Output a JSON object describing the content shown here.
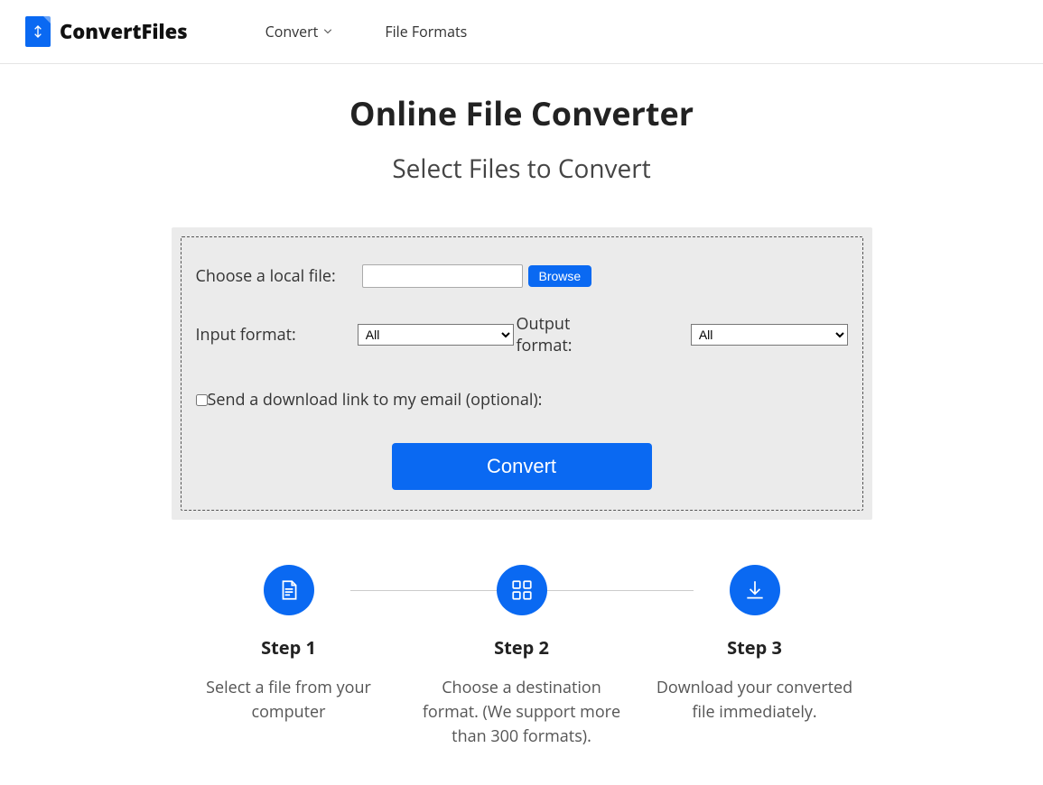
{
  "brand": "ConvertFiles",
  "nav": {
    "convert": "Convert",
    "file_formats": "File Formats"
  },
  "hero": {
    "title": "Online File Converter",
    "subtitle": "Select Files to Convert"
  },
  "form": {
    "choose_label": "Choose a local file:",
    "browse": "Browse",
    "input_format_label": "Input format:",
    "input_selected": "All",
    "output_format_label": "Output format:",
    "output_selected": "All",
    "email_checkbox_label": "Send a download link to my email (optional):",
    "convert": "Convert"
  },
  "steps": {
    "s1": {
      "title": "Step 1",
      "desc": "Select a file from your computer"
    },
    "s2": {
      "title": "Step 2",
      "desc": "Choose a destination format. (We support more than 300 formats)."
    },
    "s3": {
      "title": "Step 3",
      "desc": "Download your converted file immediately."
    }
  }
}
